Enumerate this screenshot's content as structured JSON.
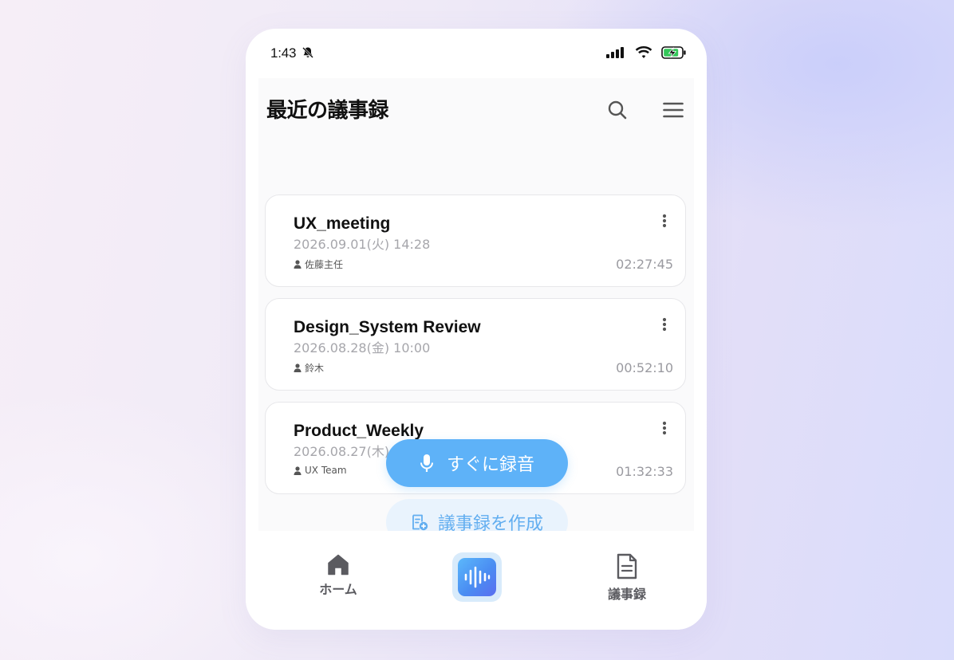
{
  "status_bar": {
    "time": "1:43",
    "icons": [
      "bell-slash-icon",
      "signal-icon",
      "wifi-icon",
      "battery-charging-icon"
    ]
  },
  "header": {
    "title": "最近の議事録",
    "search_icon": "search-icon",
    "menu_icon": "menu-icon"
  },
  "meetings": [
    {
      "title": "UX_meeting",
      "date": "2026.09.01(火) 14:28",
      "person": "佐藤主任",
      "duration": "02:27:45"
    },
    {
      "title": "Design_System Review",
      "date": "2026.08.28(金) 10:00",
      "person": "鈴木",
      "duration": "00:52:10"
    },
    {
      "title": "Product_Weekly",
      "date": "2026.08.27(木) 11:00",
      "person": "UX Team",
      "duration": "01:32:33"
    }
  ],
  "actions": {
    "record_now": "すぐに録音",
    "create_minutes": "議事録を作成"
  },
  "bottom_nav": {
    "home": "ホーム",
    "minutes": "議事録"
  },
  "colors": {
    "accent": "#5eb2f8",
    "accent_light": "#e9f3fd",
    "battery_green": "#34c759"
  }
}
